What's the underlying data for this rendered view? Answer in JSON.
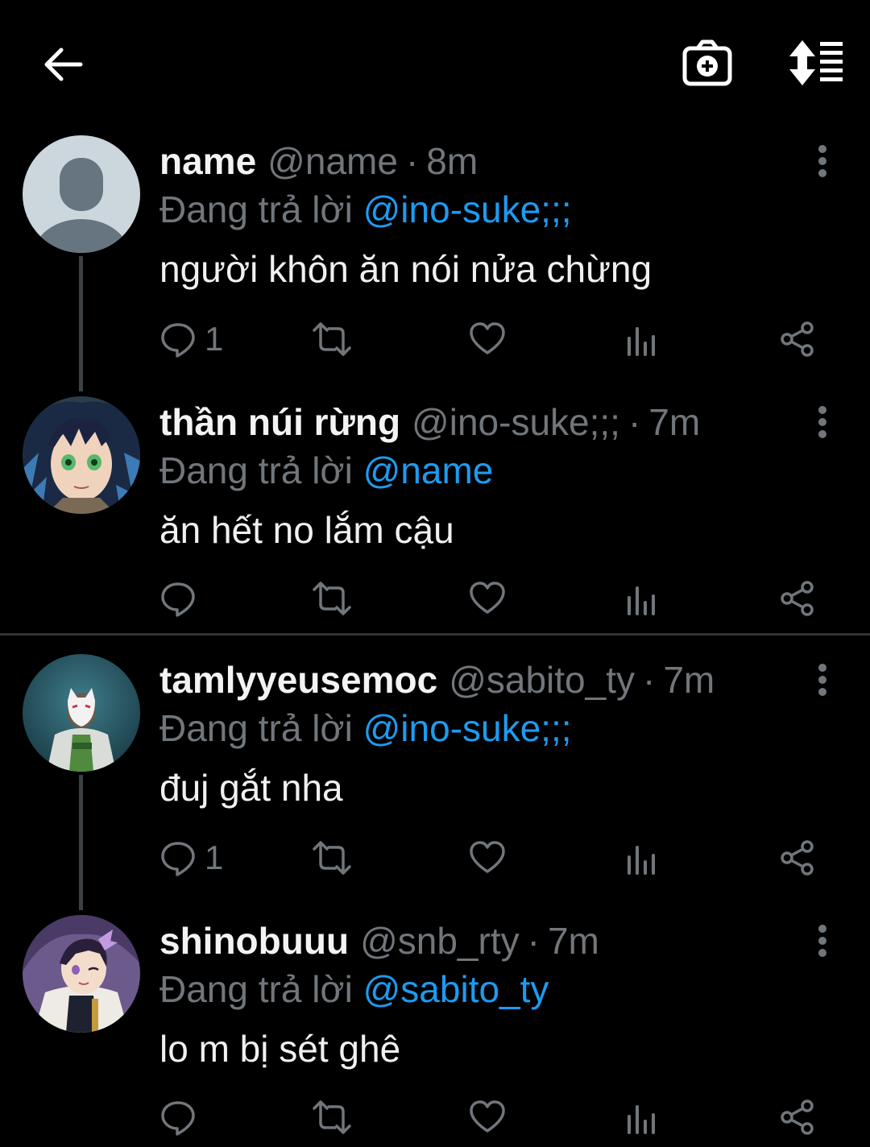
{
  "colors": {
    "background": "#000000",
    "text": "#e7e9ea",
    "muted": "#71767b",
    "mention": "#1d9bf0",
    "divider": "#2f3336"
  },
  "topbar": {
    "back_icon": "arrow-left-icon",
    "camera_icon": "camera-plus-icon",
    "sort_icon": "sort-list-icon"
  },
  "tweets": [
    {
      "display_name": "name",
      "handle": "@name",
      "separator": "·",
      "time": "8m",
      "reply_prefix": "Đang trả lời",
      "reply_to": "@ino-suke;;;",
      "text": "người khôn ăn nói nửa chừng",
      "reply_count": "1",
      "avatar": "default-avatar"
    },
    {
      "display_name": "thần núi rừng",
      "handle": "@ino-suke;;;",
      "separator": "·",
      "time": "7m",
      "reply_prefix": "Đang trả lời",
      "reply_to": "@name",
      "text": "ăn hết no lắm cậu",
      "reply_count": "",
      "avatar": "anime-boy-avatar"
    },
    {
      "display_name": "tamlyyeusemoc",
      "handle": "@sabito_ty",
      "separator": "·",
      "time": "7m",
      "reply_prefix": "Đang trả lời",
      "reply_to": "@ino-suke;;;",
      "text": "đuj gắt nha",
      "reply_count": "1",
      "avatar": "fox-mask-avatar"
    },
    {
      "display_name": "shinobuuu",
      "handle": "@snb_rty",
      "separator": "·",
      "time": "7m",
      "reply_prefix": "Đang trả lời",
      "reply_to": "@sabito_ty",
      "text": "lo m bị sét ghê",
      "reply_count": "",
      "avatar": "butterfly-girl-avatar"
    }
  ]
}
